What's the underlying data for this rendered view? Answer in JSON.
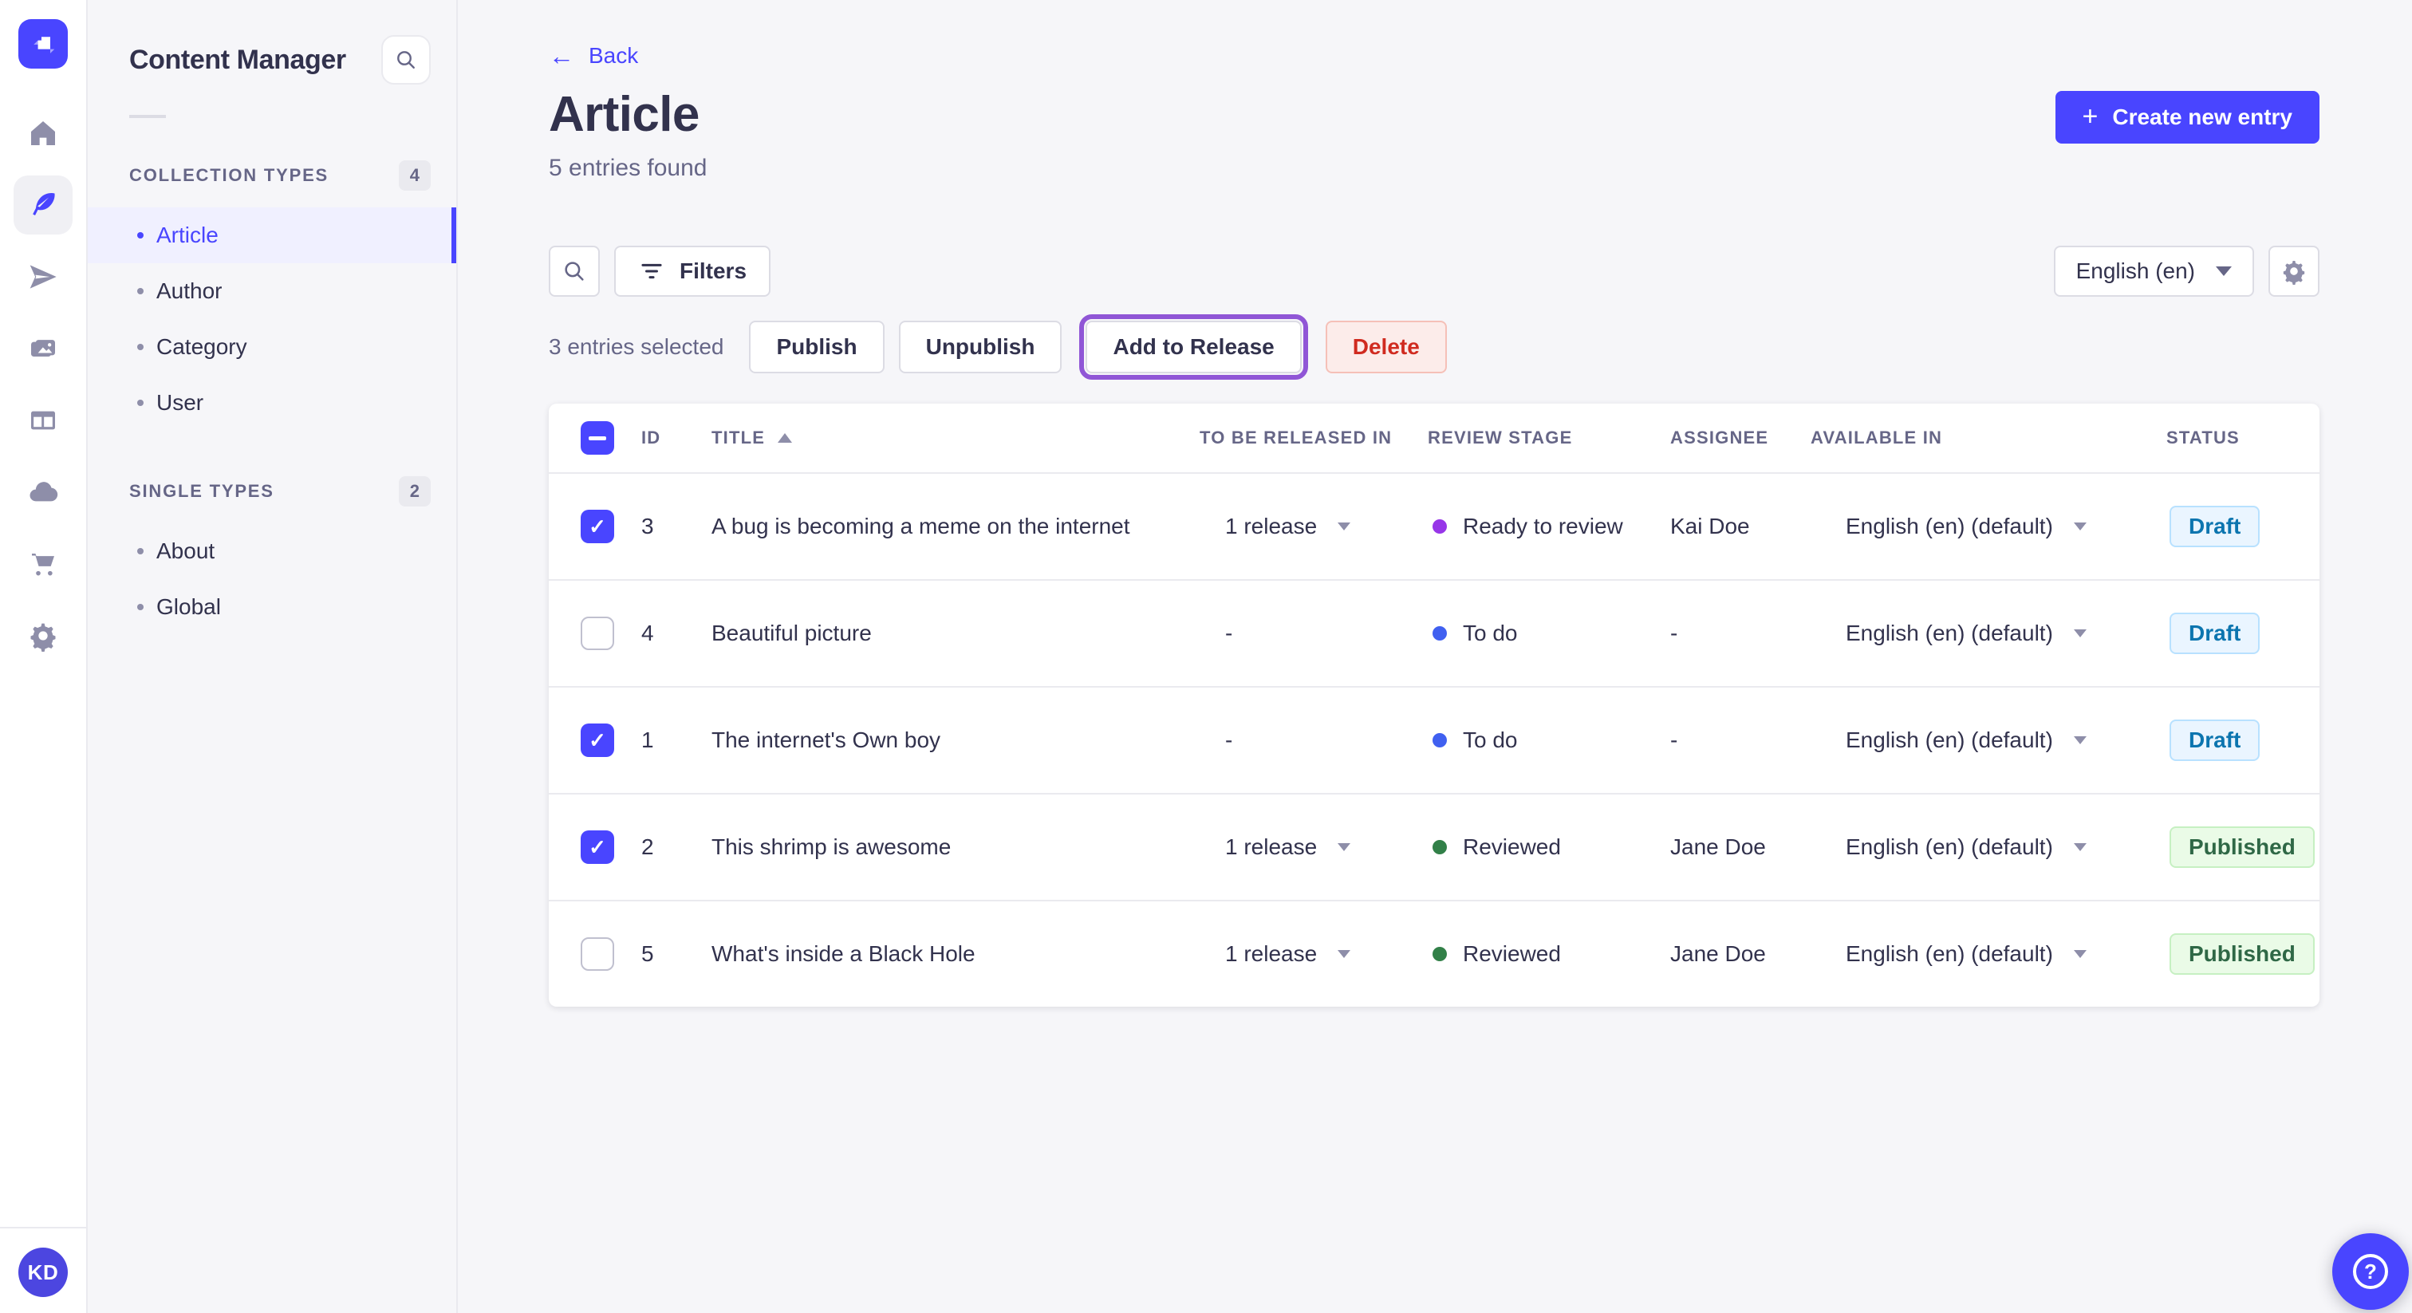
{
  "app": {
    "name": "Content Manager",
    "logo_icon": "strapi-logo-icon",
    "user_initials": "KD",
    "help_icon": "help-icon"
  },
  "nav_rail": {
    "active_index": 1,
    "items": [
      {
        "icon": "home-icon"
      },
      {
        "icon": "content-manager-icon"
      },
      {
        "icon": "releases-icon"
      },
      {
        "icon": "media-library-icon"
      },
      {
        "icon": "content-type-builder-icon"
      },
      {
        "icon": "deploy-icon"
      },
      {
        "icon": "marketplace-icon"
      },
      {
        "icon": "settings-icon"
      }
    ]
  },
  "subnav": {
    "title": "Content Manager",
    "search_icon": "search-icon",
    "sections": [
      {
        "label": "COLLECTION TYPES",
        "count": "4",
        "items": [
          {
            "label": "Article",
            "active": true
          },
          {
            "label": "Author"
          },
          {
            "label": "Category"
          },
          {
            "label": "User"
          }
        ]
      },
      {
        "label": "SINGLE TYPES",
        "count": "2",
        "items": [
          {
            "label": "About"
          },
          {
            "label": "Global"
          }
        ]
      }
    ]
  },
  "header": {
    "back_label": "Back",
    "title": "Article",
    "subtitle": "5 entries found",
    "create_button_label": "Create new entry"
  },
  "toolbar": {
    "filters_label": "Filters",
    "locale_value": "English (en)"
  },
  "selection": {
    "summary": "3 entries selected",
    "publish_label": "Publish",
    "unpublish_label": "Unpublish",
    "add_to_release_label": "Add to Release",
    "delete_label": "Delete"
  },
  "table": {
    "header_checkbox": "indeterminate",
    "columns": {
      "id": "ID",
      "title": "TITLE",
      "release": "TO BE RELEASED IN",
      "review_stage": "REVIEW STAGE",
      "assignee": "ASSIGNEE",
      "available_in": "AVAILABLE IN",
      "status": "STATUS"
    },
    "sort": {
      "column": "TITLE",
      "direction": "asc"
    },
    "rows": [
      {
        "checked": true,
        "id": "3",
        "title": "A bug is becoming a meme on the internet",
        "release": "1 release",
        "review_stage": "Ready to review",
        "review_color": "#9736e8",
        "assignee": "Kai Doe",
        "available_in": "English (en) (default)",
        "status": "Draft"
      },
      {
        "checked": false,
        "id": "4",
        "title": "Beautiful picture",
        "release": "-",
        "review_stage": "To do",
        "review_color": "#4060f0",
        "assignee": "-",
        "available_in": "English (en) (default)",
        "status": "Draft"
      },
      {
        "checked": true,
        "id": "1",
        "title": "The internet's Own boy",
        "release": "-",
        "review_stage": "To do",
        "review_color": "#4060f0",
        "assignee": "-",
        "available_in": "English (en) (default)",
        "status": "Draft"
      },
      {
        "checked": true,
        "id": "2",
        "title": "This shrimp is awesome",
        "release": "1 release",
        "review_stage": "Reviewed",
        "review_color": "#328048",
        "assignee": "Jane Doe",
        "available_in": "English (en) (default)",
        "status": "Published"
      },
      {
        "checked": false,
        "id": "5",
        "title": "What's inside a Black Hole",
        "release": "1 release",
        "review_stage": "Reviewed",
        "review_color": "#328048",
        "assignee": "Jane Doe",
        "available_in": "English (en) (default)",
        "status": "Published"
      }
    ]
  },
  "colors": {
    "primary": "#4945ff",
    "draft_bg": "#eaf5ff",
    "draft_text": "#0c75af",
    "draft_border": "#b8e1ff",
    "published_bg": "#eafbe7",
    "published_text": "#2f6846",
    "published_border": "#c6f0c2",
    "danger_text": "#d02b20",
    "danger_bg": "#fcecea",
    "release_outline": "#9056d6"
  }
}
